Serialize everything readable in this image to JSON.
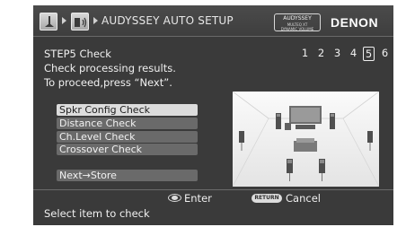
{
  "header": {
    "breadcrumb_title": "AUDYSSEY AUTO SETUP",
    "badge": {
      "line1": "AUDYSSEY",
      "line2": "MULTEQ XT",
      "line3": "DYNAMIC VOLUME"
    },
    "brand": "DENON",
    "icons": [
      "setup-icon",
      "speaker-icon"
    ]
  },
  "step": {
    "title": "STEP5 Check",
    "instruction_line1": "Check processing results.",
    "instruction_line2": "To proceed,press “Next”.",
    "numbers": [
      "1",
      "2",
      "3",
      "5",
      "6"
    ],
    "box_number": "4",
    "current": "5"
  },
  "menu": {
    "items": [
      {
        "label": "Spkr Config Check",
        "selected": true
      },
      {
        "label": "Distance Check",
        "selected": false
      },
      {
        "label": "Ch.Level Check",
        "selected": false
      },
      {
        "label": "Crossover Check",
        "selected": false
      }
    ],
    "next_label": "Next→Store"
  },
  "footer": {
    "enter_label": "Enter",
    "return_label": "RETURN",
    "cancel_label": "Cancel",
    "status": "Select item to check"
  },
  "colors": {
    "frame_bg": "#3a3a3a",
    "text": "#f0f0f0",
    "menu_item_bg": "#6a6a6a",
    "menu_selected_bg": "#dcdcdc"
  }
}
